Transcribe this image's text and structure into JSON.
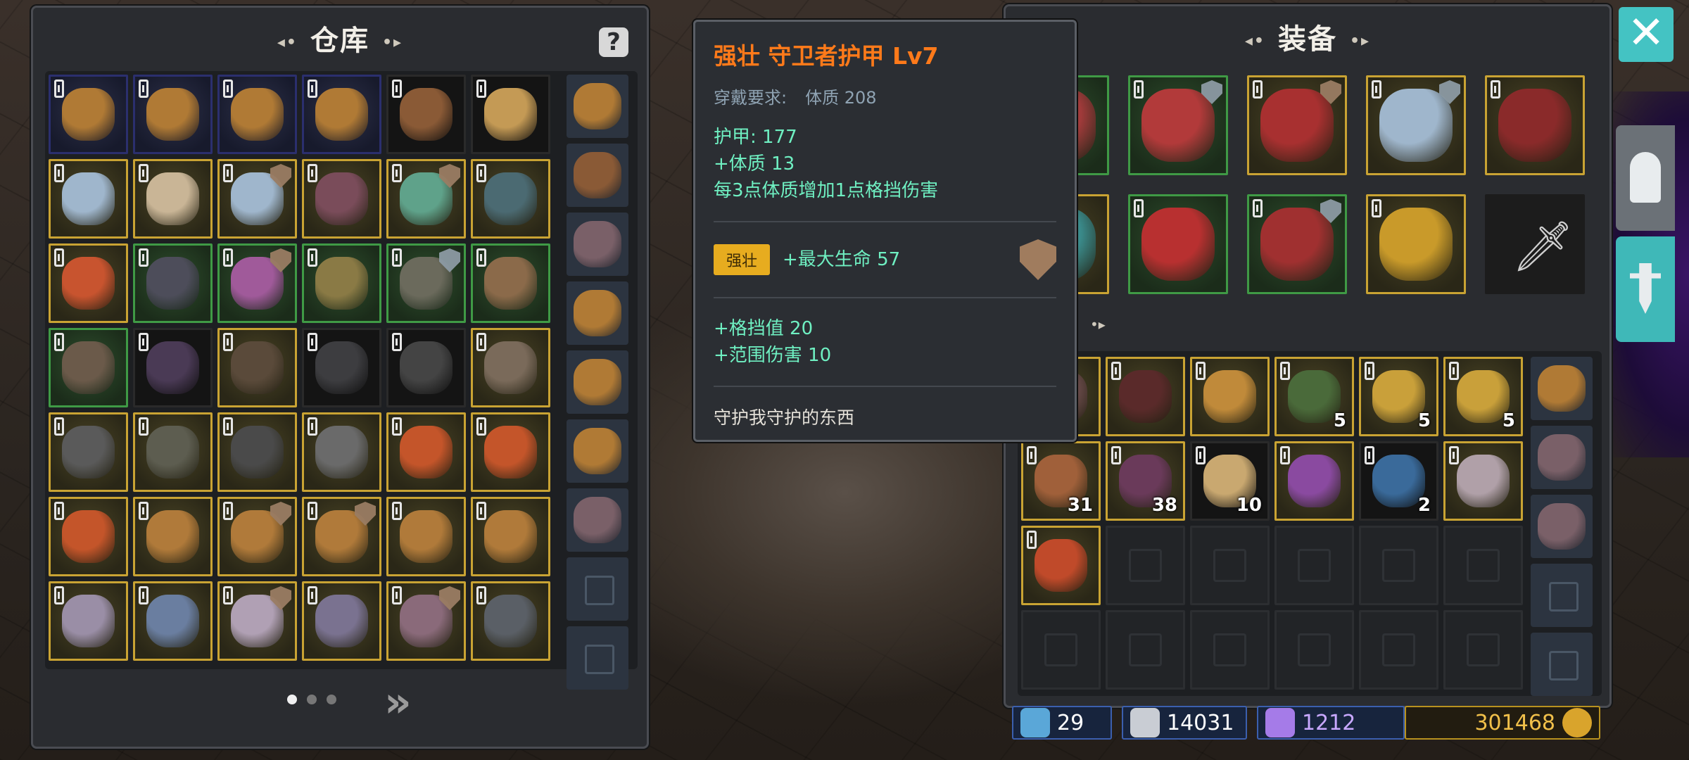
{
  "warehouse": {
    "title": "仓库",
    "help": "?",
    "next": "»",
    "slots": [
      {
        "b": "blue",
        "c": "#b07a35"
      },
      {
        "b": "blue",
        "c": "#b07a35"
      },
      {
        "b": "blue",
        "c": "#b07a35"
      },
      {
        "b": "blue",
        "c": "#b07a35"
      },
      {
        "b": "dark",
        "c": "#8a5a36"
      },
      {
        "b": "dark",
        "c": "#c49a55"
      },
      {
        "b": "yellow",
        "c": "#9fb6cc"
      },
      {
        "b": "yellow",
        "c": "#c9b596"
      },
      {
        "b": "yellow",
        "c": "#9fb6cc",
        "s": "bronze"
      },
      {
        "b": "yellow",
        "c": "#7a4c5a"
      },
      {
        "b": "yellow",
        "c": "#5fa28a",
        "s": "bronze"
      },
      {
        "b": "yellow",
        "c": "#4b6a72"
      },
      {
        "b": "yellow",
        "c": "#c8542f"
      },
      {
        "b": "green",
        "c": "#4d4d5a"
      },
      {
        "b": "green",
        "c": "#a05a9a",
        "s": "bronze"
      },
      {
        "b": "green",
        "c": "#8a7a45"
      },
      {
        "b": "green",
        "c": "#6b6a5c",
        "s": "silver"
      },
      {
        "b": "green",
        "c": "#8b6a4a"
      },
      {
        "b": "green",
        "c": "#6b5a4a"
      },
      {
        "b": "dark",
        "c": "#4a3a55"
      },
      {
        "b": "yellow",
        "c": "#5a4a3a"
      },
      {
        "b": "dark",
        "c": "#3d3d40"
      },
      {
        "b": "dark",
        "c": "#444444"
      },
      {
        "b": "yellow",
        "c": "#7a6a5a"
      },
      {
        "b": "yellow",
        "c": "#5a5a5a"
      },
      {
        "b": "yellow",
        "c": "#5d5d50"
      },
      {
        "b": "yellow",
        "c": "#4a4a4a"
      },
      {
        "b": "yellow",
        "c": "#6a6a6a"
      },
      {
        "b": "yellow",
        "c": "#c4552a"
      },
      {
        "b": "yellow",
        "c": "#c4552a"
      },
      {
        "b": "yellow",
        "c": "#c4552a"
      },
      {
        "b": "yellow",
        "c": "#b07a3a"
      },
      {
        "b": "yellow",
        "c": "#b07a3a",
        "s": "bronze"
      },
      {
        "b": "yellow",
        "c": "#b07a3a",
        "s": "bronze"
      },
      {
        "b": "yellow",
        "c": "#b07a3a"
      },
      {
        "b": "yellow",
        "c": "#b07a3a"
      },
      {
        "b": "yellow",
        "c": "#9a8ea6"
      },
      {
        "b": "yellow",
        "c": "#6a7ea0"
      },
      {
        "b": "yellow",
        "c": "#b0a0b4",
        "s": "bronze"
      },
      {
        "b": "yellow",
        "c": "#7a7290"
      },
      {
        "b": "yellow",
        "c": "#8a6a7a",
        "s": "bronze"
      },
      {
        "b": "yellow",
        "c": "#5a5f66"
      }
    ],
    "side": [
      {
        "c": "#b07a35"
      },
      {
        "c": "#8a5a36"
      },
      {
        "c": "#7a6068"
      },
      {
        "c": "#b07a35"
      },
      {
        "c": "#b07a35"
      },
      {
        "c": "#b07a35"
      },
      {
        "c": "#7a6068"
      },
      {
        "c": null
      },
      {
        "c": null
      }
    ]
  },
  "tooltip": {
    "title": "强壮 守卫者护甲 Lv7",
    "req_label": "穿戴要求:",
    "req_value": "体质 208",
    "armor": "护甲: 177",
    "stat1": "+体质 13",
    "stat2": "每3点体质增加1点格挡伤害",
    "affix_tag": "强壮",
    "affix_text": "+最大生命 57",
    "stat3": "+格挡值 20",
    "stat4": "+范围伤害 10",
    "flavor": "守护我守护的东西"
  },
  "equipment": {
    "title": "装备",
    "gear": [
      {
        "b": "green",
        "c": "#a03a3a"
      },
      {
        "b": "green",
        "c": "#b23a3a",
        "s": "silver"
      },
      {
        "b": "yellow",
        "c": "#a83030",
        "s": "bronze"
      },
      {
        "b": "yellow",
        "c": "#9fb6cc",
        "s": "silver"
      },
      {
        "b": "yellow",
        "c": "#8a2a2a"
      },
      {
        "b": "yellow",
        "c": "#3a8a8a"
      },
      {
        "b": "green",
        "c": "#b83030"
      },
      {
        "b": "green",
        "c": "#a03030",
        "s": "silver"
      },
      {
        "b": "yellow",
        "c": "#c99a2a"
      },
      {
        "b": "sword",
        "c": null
      }
    ]
  },
  "bag": {
    "slots": [
      {
        "b": "yellow",
        "c": "#6a4a4a",
        "n": ""
      },
      {
        "b": "yellow",
        "c": "#5a2a2a",
        "n": ""
      },
      {
        "b": "yellow",
        "c": "#c08a3a",
        "n": ""
      },
      {
        "b": "yellow",
        "c": "#4a6a3a",
        "n": "5"
      },
      {
        "b": "yellow",
        "c": "#c9a03a",
        "n": "5"
      },
      {
        "b": "yellow",
        "c": "#c9a03a",
        "n": "5"
      },
      {
        "b": "yellow",
        "c": "#a0603a",
        "n": "31"
      },
      {
        "b": "yellow",
        "c": "#6a3a5a",
        "n": "38"
      },
      {
        "b": "dark",
        "c": "#c9a870",
        "n": "10"
      },
      {
        "b": "yellow",
        "c": "#8a4aa0",
        "n": ""
      },
      {
        "b": "dark",
        "c": "#3a6a9a",
        "n": "2"
      },
      {
        "b": "yellow",
        "c": "#b0a0a8",
        "n": ""
      },
      {
        "b": "yellow",
        "c": "#c04a2a",
        "n": ""
      },
      {
        "b": "empty",
        "c": null,
        "n": ""
      },
      {
        "b": "empty",
        "c": null,
        "n": ""
      },
      {
        "b": "empty",
        "c": null,
        "n": ""
      },
      {
        "b": "empty",
        "c": null,
        "n": ""
      },
      {
        "b": "empty",
        "c": null,
        "n": ""
      },
      {
        "b": "empty",
        "c": null,
        "n": ""
      },
      {
        "b": "empty",
        "c": null,
        "n": ""
      },
      {
        "b": "empty",
        "c": null,
        "n": ""
      },
      {
        "b": "empty",
        "c": null,
        "n": ""
      },
      {
        "b": "empty",
        "c": null,
        "n": ""
      },
      {
        "b": "empty",
        "c": null,
        "n": ""
      }
    ],
    "side": [
      {
        "c": "#b07a35"
      },
      {
        "c": "#7a6068"
      },
      {
        "c": "#7a6068"
      },
      {
        "c": null
      },
      {
        "c": null
      }
    ]
  },
  "currency": {
    "keys": "29",
    "silver": "14031",
    "gems": "1212",
    "gold": "301468"
  },
  "close": "✕"
}
